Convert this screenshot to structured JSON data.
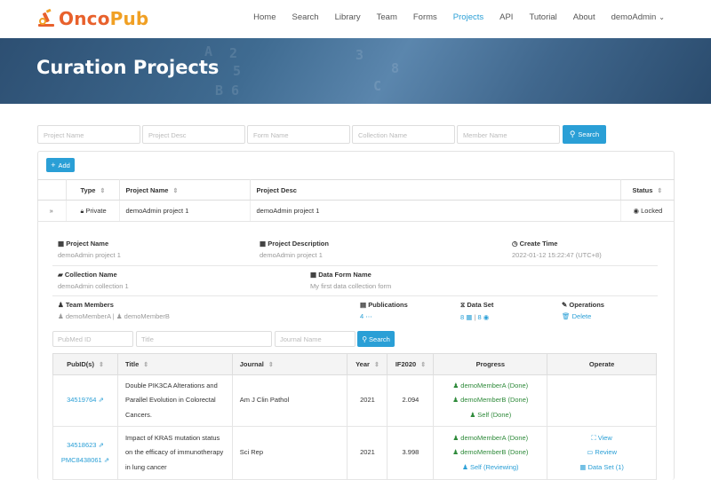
{
  "nav": {
    "brand": "OncoPub",
    "items": [
      "Home",
      "Search",
      "Library",
      "Team",
      "Forms",
      "Projects",
      "API",
      "Tutorial",
      "About"
    ],
    "active": "Projects",
    "user": "demoAdmin"
  },
  "banner": {
    "title": "Curation Projects",
    "bg_chars": [
      "A",
      "2",
      "5",
      "B",
      "6",
      "3",
      "C",
      "8"
    ]
  },
  "filters": {
    "project_name": "Project Name",
    "project_desc": "Project Desc",
    "form_name": "Form Name",
    "collection_name": "Collection Name",
    "member_name": "Member Name",
    "search_label": "Search"
  },
  "add_label": "Add",
  "projects_table": {
    "headers": [
      "Type",
      "Project Name",
      "Project Desc",
      "Status"
    ],
    "row": {
      "expand": "»",
      "type": "Private",
      "name": "demoAdmin project 1",
      "desc": "demoAdmin project 1",
      "status": "Locked"
    }
  },
  "details": {
    "project_name_label": "Project Name",
    "project_name": "demoAdmin project 1",
    "project_desc_label": "Project Description",
    "project_desc": "demoAdmin project 1",
    "create_time_label": "Create Time",
    "create_time": "2022-01-12 15:22:47 (UTC+8)",
    "collection_label": "Collection Name",
    "collection": "demoAdmin collection 1",
    "form_label": "Data Form Name",
    "form": "My first data collection form",
    "members_label": "Team Members",
    "member_a": "demoMemberA",
    "member_sep": "|",
    "member_b": "demoMemberB",
    "publications_label": "Publications",
    "publications": "4",
    "dataset_label": "Data Set",
    "dataset_a": "8",
    "dataset_sep": "|",
    "dataset_b": "8",
    "operations_label": "Operations",
    "delete_label": "Delete"
  },
  "pub_filters": {
    "pubmed": "PubMed ID",
    "title": "Title",
    "journal": "Journal Name",
    "search_label": "Search"
  },
  "pub_table": {
    "headers": [
      "PubID(s)",
      "Title",
      "Journal",
      "Year",
      "IF2020",
      "Progress",
      "Operate"
    ],
    "rows": [
      {
        "ids": [
          "34519764"
        ],
        "title": "Double PIK3CA Alterations and Parallel Evolution in Colorectal Cancers.",
        "journal": "Am J Clin Pathol",
        "year": "2021",
        "if": "2.094",
        "progress": [
          "demoMemberA (Done)",
          "demoMemberB (Done)",
          "Self (Done)"
        ],
        "operate": []
      },
      {
        "ids": [
          "34518623",
          "PMC8438061"
        ],
        "title": "Impact of KRAS mutation status on the efficacy of immunotherapy in lung cancer",
        "journal": "Sci Rep",
        "year": "2021",
        "if": "3.998",
        "progress": [
          "demoMemberA (Done)",
          "demoMemberB (Done)",
          "Self (Reviewing)"
        ],
        "operate": [
          "View",
          "Review",
          "Data Set (1)"
        ]
      }
    ]
  }
}
